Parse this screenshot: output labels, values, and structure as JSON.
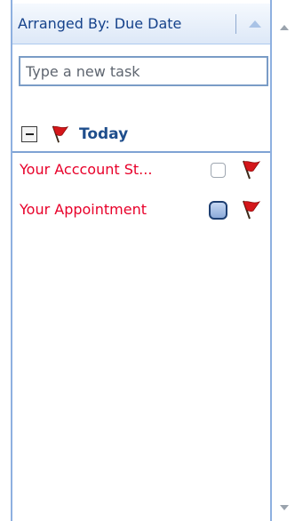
{
  "header": {
    "arranged_by": "Arranged By: Due Date"
  },
  "new_task": {
    "placeholder": "Type a new task"
  },
  "group": {
    "label": "Today"
  },
  "tasks": [
    {
      "title": "Your Acccount St...",
      "completed": false
    },
    {
      "title": "Your Appointment",
      "completed": false
    }
  ],
  "icons": {
    "sort": "sort-ascending-icon",
    "collapse": "collapse-minus-icon",
    "flag": "red-flag-icon",
    "scroll_up": "scroll-up-arrow-icon",
    "scroll_down": "scroll-down-arrow-icon"
  },
  "colors": {
    "border": "#8eb0e0",
    "header_text": "#15428b",
    "group_text": "#1f4e8c",
    "task_text": "#e8002a",
    "flag": "#d4161a"
  }
}
